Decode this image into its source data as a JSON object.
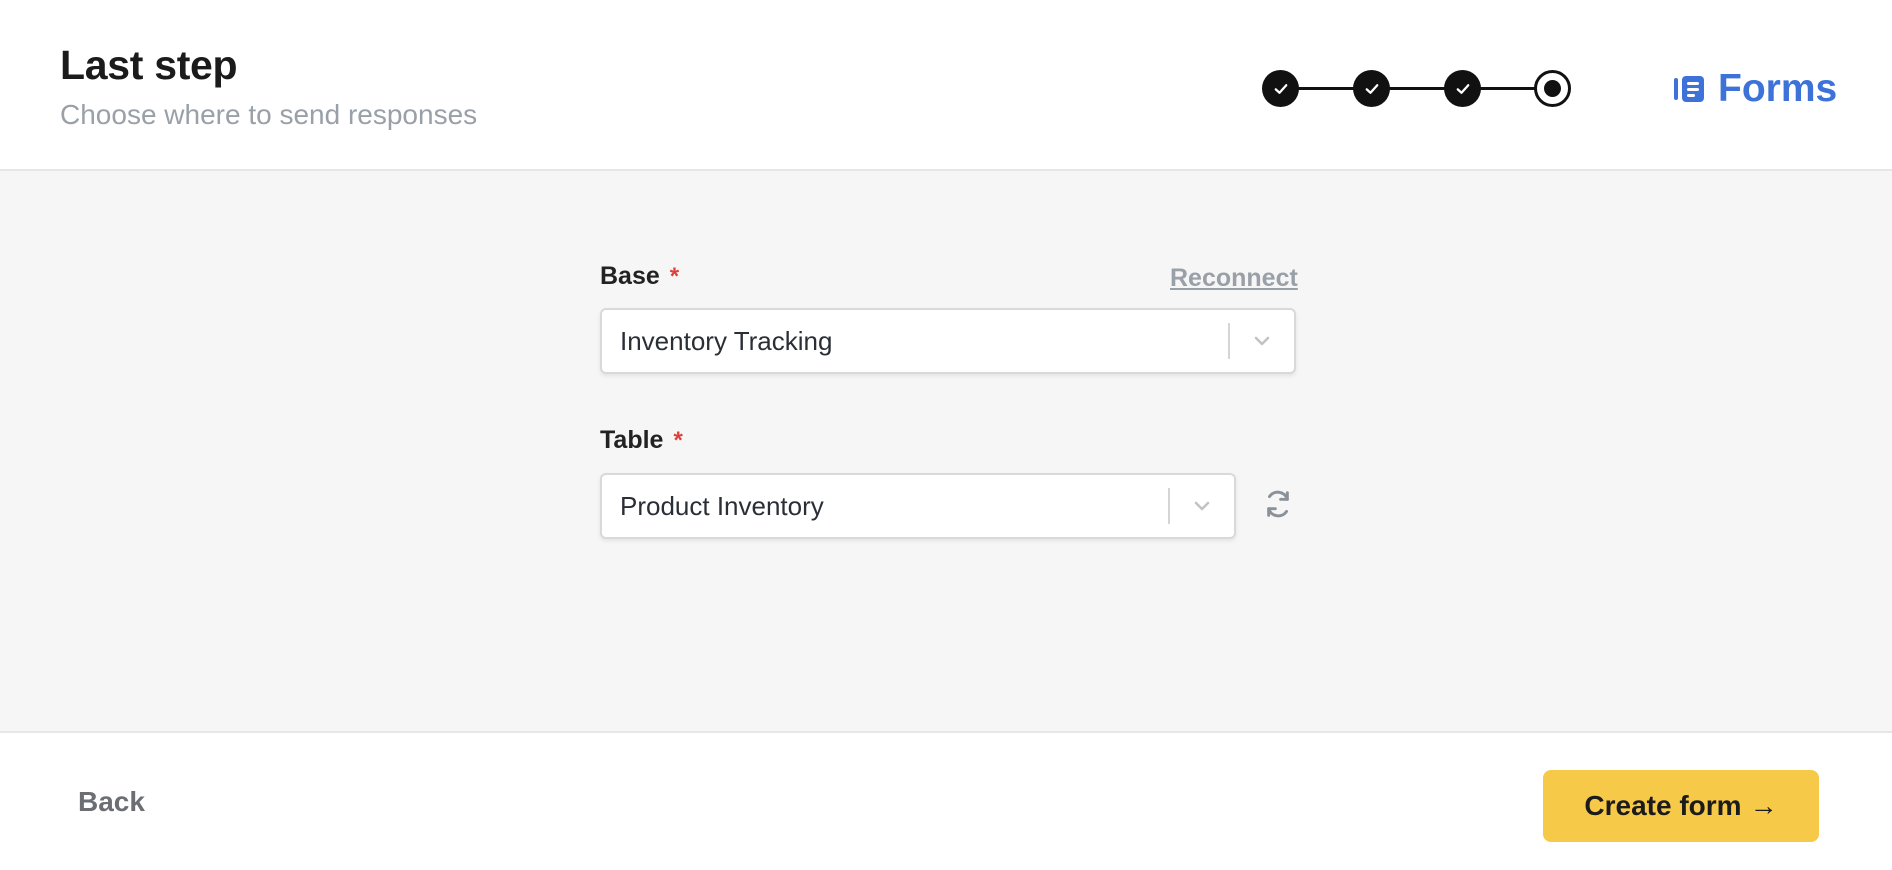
{
  "header": {
    "title": "Last step",
    "subtitle": "Choose where to send responses"
  },
  "stepper": {
    "total_steps": 4,
    "current_step": 4,
    "step_states": [
      "complete",
      "complete",
      "complete",
      "current"
    ]
  },
  "brand": {
    "icon": "forms-icon",
    "name": "Forms",
    "color": "#3d73d9"
  },
  "form": {
    "base": {
      "label": "Base",
      "required_marker": "*",
      "value": "Inventory Tracking",
      "reconnect_label": "Reconnect"
    },
    "table": {
      "label": "Table",
      "required_marker": "*",
      "value": "Product Inventory",
      "refresh_icon": "refresh-icon"
    }
  },
  "footer": {
    "back_label": "Back",
    "create_label": "Create form",
    "create_arrow": "→",
    "create_color": "#f7c948"
  }
}
